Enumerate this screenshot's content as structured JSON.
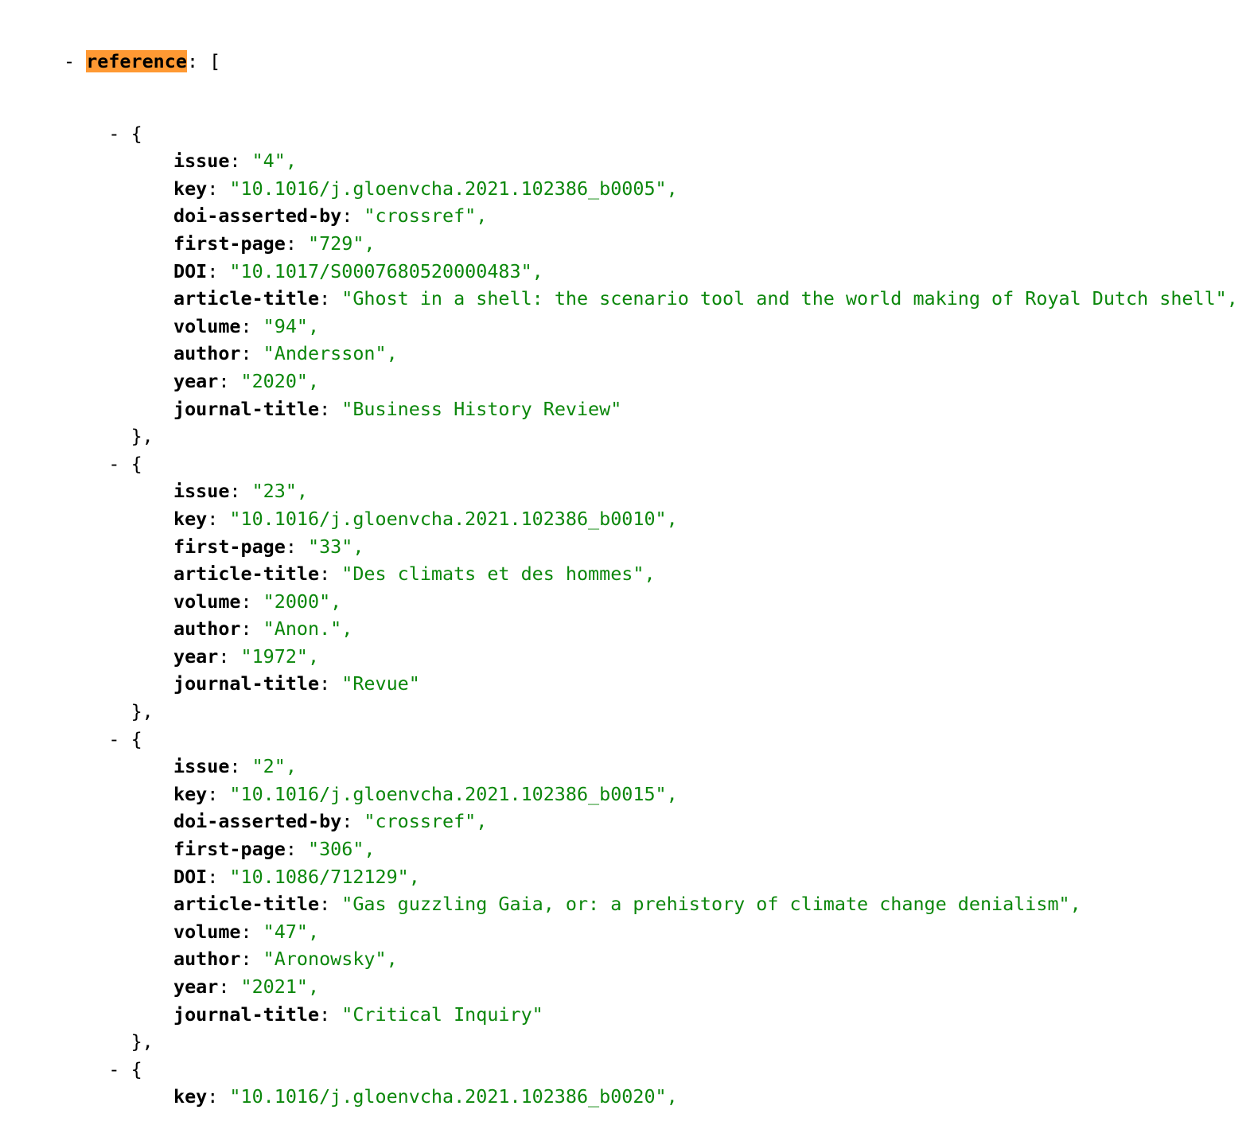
{
  "viewer": {
    "root_key": "reference",
    "root_open": "[",
    "collapse_glyph": "-",
    "object_open": "{",
    "object_close": "},",
    "highlight_color": "#ff9933",
    "string_color": "#0b870b",
    "items": [
      {
        "fields": [
          {
            "key": "issue",
            "value": "\"4\","
          },
          {
            "key": "key",
            "value": "\"10.1016/j.gloenvcha.2021.102386_b0005\","
          },
          {
            "key": "doi-asserted-by",
            "value": "\"crossref\","
          },
          {
            "key": "first-page",
            "value": "\"729\","
          },
          {
            "key": "DOI",
            "value": "\"10.1017/S0007680520000483\","
          },
          {
            "key": "article-title",
            "value": "\"Ghost in a shell: the scenario tool and the world making of Royal Dutch shell\","
          },
          {
            "key": "volume",
            "value": "\"94\","
          },
          {
            "key": "author",
            "value": "\"Andersson\","
          },
          {
            "key": "year",
            "value": "\"2020\","
          },
          {
            "key": "journal-title",
            "value": "\"Business History Review\""
          }
        ]
      },
      {
        "fields": [
          {
            "key": "issue",
            "value": "\"23\","
          },
          {
            "key": "key",
            "value": "\"10.1016/j.gloenvcha.2021.102386_b0010\","
          },
          {
            "key": "first-page",
            "value": "\"33\","
          },
          {
            "key": "article-title",
            "value": "\"Des climats et des hommes\","
          },
          {
            "key": "volume",
            "value": "\"2000\","
          },
          {
            "key": "author",
            "value": "\"Anon.\","
          },
          {
            "key": "year",
            "value": "\"1972\","
          },
          {
            "key": "journal-title",
            "value": "\"Revue\""
          }
        ]
      },
      {
        "fields": [
          {
            "key": "issue",
            "value": "\"2\","
          },
          {
            "key": "key",
            "value": "\"10.1016/j.gloenvcha.2021.102386_b0015\","
          },
          {
            "key": "doi-asserted-by",
            "value": "\"crossref\","
          },
          {
            "key": "first-page",
            "value": "\"306\","
          },
          {
            "key": "DOI",
            "value": "\"10.1086/712129\","
          },
          {
            "key": "article-title",
            "value": "\"Gas guzzling Gaia, or: a prehistory of climate change denialism\","
          },
          {
            "key": "volume",
            "value": "\"47\","
          },
          {
            "key": "author",
            "value": "\"Aronowsky\","
          },
          {
            "key": "year",
            "value": "\"2021\","
          },
          {
            "key": "journal-title",
            "value": "\"Critical Inquiry\""
          }
        ]
      },
      {
        "fields": [
          {
            "key": "key",
            "value": "\"10.1016/j.gloenvcha.2021.102386_b0020\","
          }
        ],
        "truncated": true
      }
    ]
  }
}
